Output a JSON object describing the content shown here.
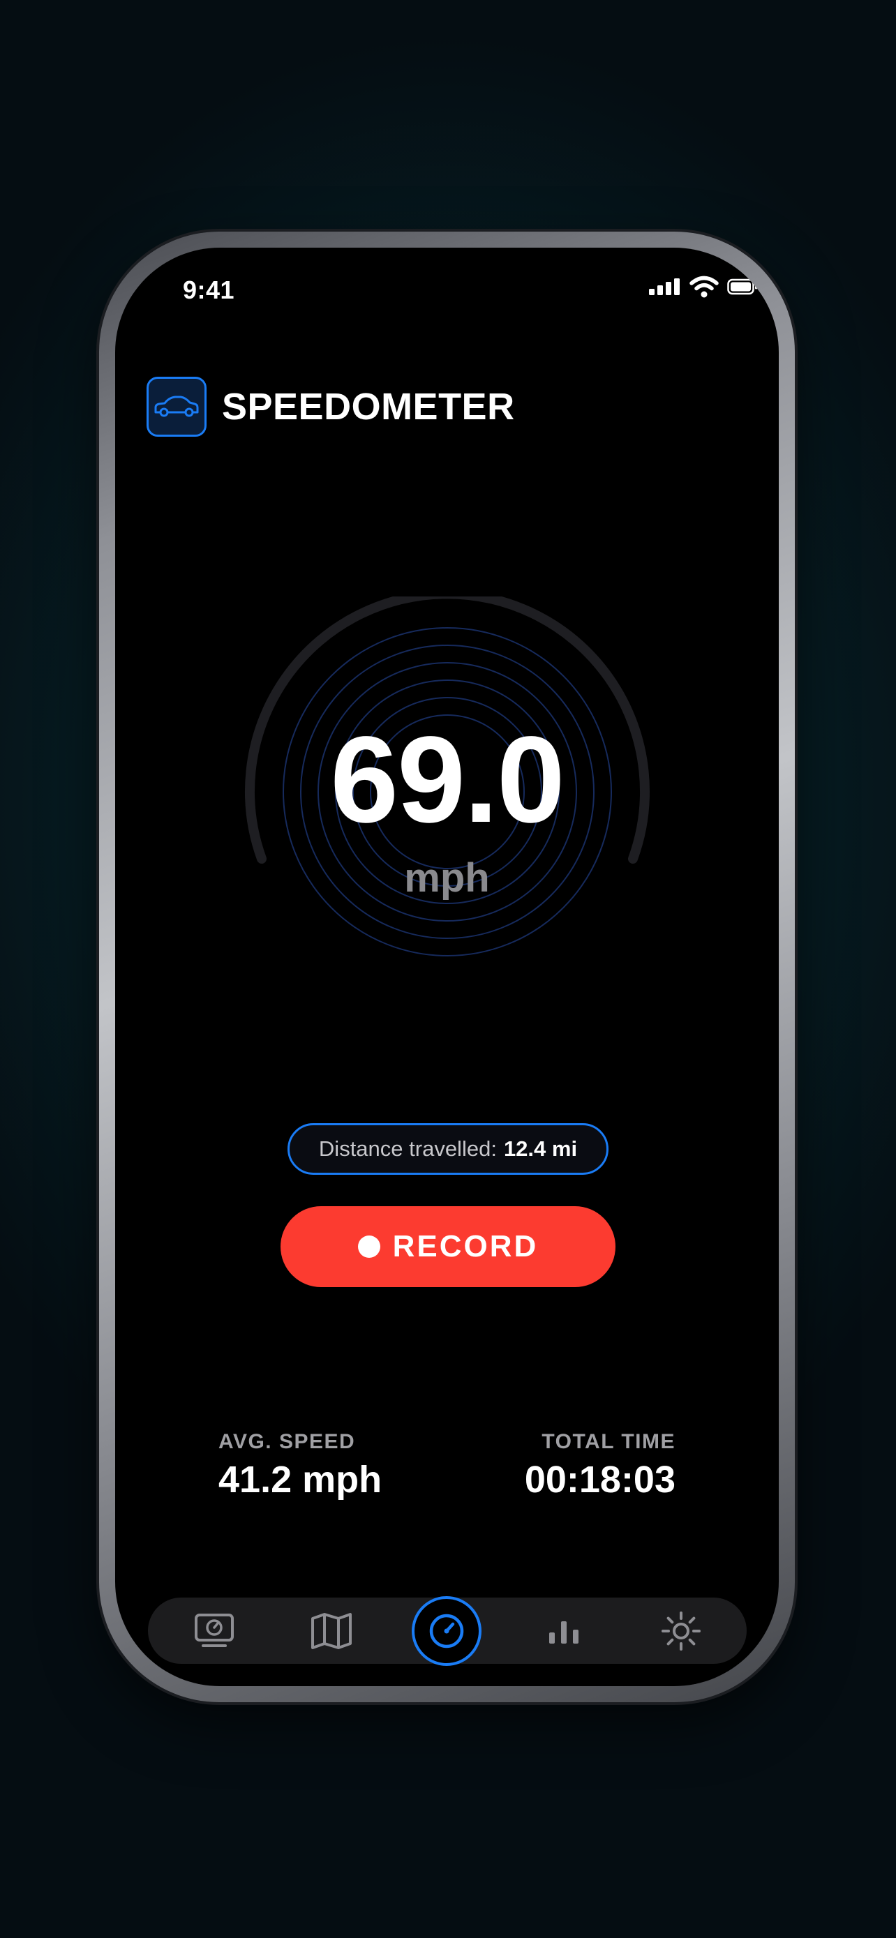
{
  "status_bar": {
    "time": "9:41"
  },
  "header": {
    "title": "SPEEDOMETER",
    "logo_icon": "car-icon"
  },
  "speedometer": {
    "value": "69.0",
    "unit": "mph"
  },
  "distance": {
    "label": "Distance travelled:",
    "value": "12.4 mi"
  },
  "record_button": {
    "label": "RECORD"
  },
  "stats": {
    "avg_speed": {
      "label": "AVG. SPEED",
      "value": "41.2 mph"
    },
    "total_time": {
      "label": "TOTAL TIME",
      "value": "00:18:03"
    }
  },
  "tab_bar": {
    "tabs": [
      {
        "icon": "dashboard-monitor-icon",
        "active": false
      },
      {
        "icon": "map-icon",
        "active": false
      },
      {
        "icon": "speedometer-icon",
        "active": true
      },
      {
        "icon": "bar-chart-icon",
        "active": false
      },
      {
        "icon": "sun-settings-icon",
        "active": false
      }
    ]
  },
  "colors": {
    "accent": "#1a7cf5",
    "record": "#fc3b30",
    "background": "#000000"
  }
}
